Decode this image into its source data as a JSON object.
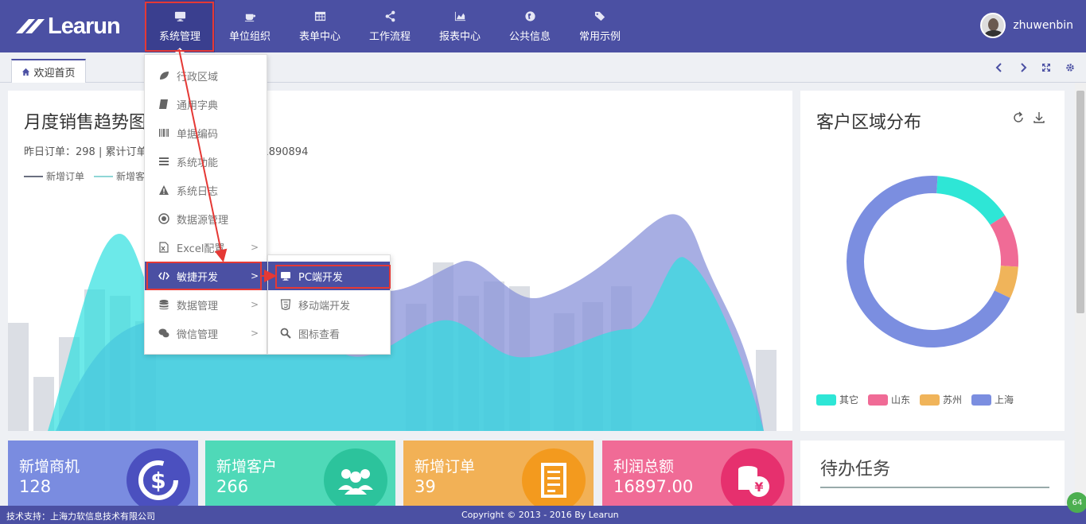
{
  "app": {
    "logo_text": "Learun"
  },
  "nav": {
    "items": [
      {
        "label": "系统管理",
        "icon": "monitor-icon"
      },
      {
        "label": "单位组织",
        "icon": "coffee-icon"
      },
      {
        "label": "表单中心",
        "icon": "table-icon"
      },
      {
        "label": "工作流程",
        "icon": "share-icon"
      },
      {
        "label": "报表中心",
        "icon": "area-chart-icon"
      },
      {
        "label": "公共信息",
        "icon": "globe-icon"
      },
      {
        "label": "常用示例",
        "icon": "tags-icon"
      }
    ],
    "active_index": 0
  },
  "user": {
    "name": "zhuwenbin"
  },
  "tabs": {
    "home_label": "欢迎首页"
  },
  "sales_chart": {
    "title": "月度销售趋势图",
    "subtitle": "昨日订单：298 | 累计订单 … 9840 | 累计交易额：1890894",
    "legend": [
      "新增订单",
      "新增客户"
    ]
  },
  "region_chart": {
    "title": "客户区域分布"
  },
  "chart_data": {
    "type": "pie",
    "title": "客户区域分布",
    "donut": true,
    "labels": [
      "其它",
      "山东",
      "苏州",
      "上海"
    ],
    "values": [
      15,
      10,
      6,
      69
    ],
    "colors": [
      "#2ee6d6",
      "#f06b96",
      "#f0b45a",
      "#7b8ee0"
    ],
    "legend_position": "bottom-left"
  },
  "stats": [
    {
      "label": "新增商机",
      "value": "128",
      "color": "#7a8ce0",
      "icon_color": "#5a63c8",
      "icon": "dollar-icon"
    },
    {
      "label": "新增客户",
      "value": "266",
      "color": "#4fd9b8",
      "icon_color": "#2fc39e",
      "icon": "users-icon"
    },
    {
      "label": "新增订单",
      "value": "39",
      "color": "#f2b156",
      "icon_color": "#f39a20",
      "icon": "document-icon"
    },
    {
      "label": "利润总额",
      "value": "16897.00",
      "color": "#f06b96",
      "icon_color": "#e8336f",
      "icon": "yen-coins-icon"
    }
  ],
  "todo": {
    "title": "待办任务"
  },
  "dropdown": {
    "items": [
      {
        "label": "行政区域",
        "icon": "leaf-icon",
        "has_sub": false
      },
      {
        "label": "通用字典",
        "icon": "book-icon",
        "has_sub": false
      },
      {
        "label": "单据编码",
        "icon": "barcode-icon",
        "has_sub": false
      },
      {
        "label": "系统功能",
        "icon": "list-icon",
        "has_sub": false
      },
      {
        "label": "系统日志",
        "icon": "warning-icon",
        "has_sub": false
      },
      {
        "label": "数据源管理",
        "icon": "target-icon",
        "has_sub": false
      },
      {
        "label": "Excel配置",
        "icon": "excel-icon",
        "has_sub": true
      },
      {
        "label": "敏捷开发",
        "icon": "code-icon",
        "has_sub": true
      },
      {
        "label": "数据管理",
        "icon": "database-icon",
        "has_sub": true
      },
      {
        "label": "微信管理",
        "icon": "wechat-icon",
        "has_sub": true
      }
    ],
    "active_index": 7
  },
  "submenu": {
    "items": [
      {
        "label": "PC端开发",
        "icon": "monitor-icon"
      },
      {
        "label": "移动端开发",
        "icon": "html5-icon"
      },
      {
        "label": "图标查看",
        "icon": "search-icon"
      }
    ],
    "active_index": 0
  },
  "footer": {
    "support": "技术支持：上海力软信息技术有限公司",
    "copyright": "Copyright © 2013 - 2016 By Learun"
  },
  "badge": {
    "value": "64"
  }
}
